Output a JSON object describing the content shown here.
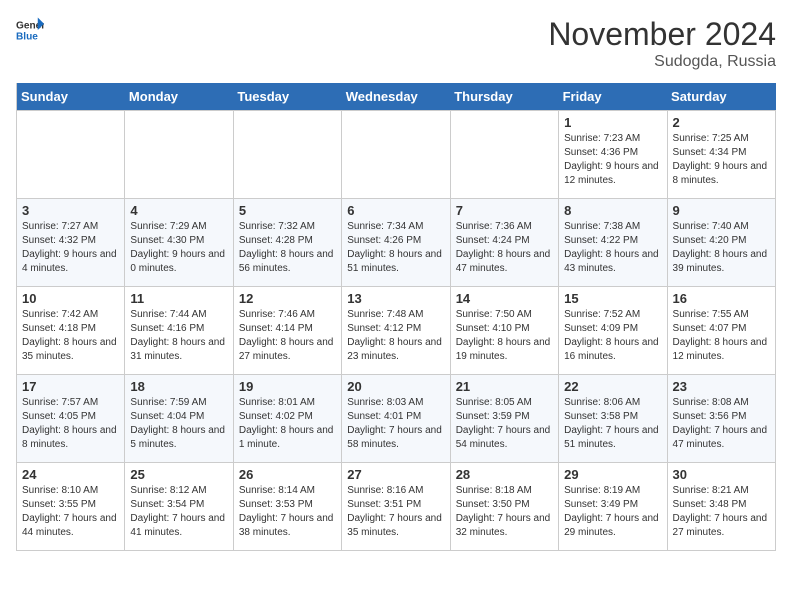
{
  "logo": {
    "text_general": "General",
    "text_blue": "Blue"
  },
  "title": "November 2024",
  "location": "Sudogda, Russia",
  "days_of_week": [
    "Sunday",
    "Monday",
    "Tuesday",
    "Wednesday",
    "Thursday",
    "Friday",
    "Saturday"
  ],
  "weeks": [
    [
      {
        "day": "",
        "info": ""
      },
      {
        "day": "",
        "info": ""
      },
      {
        "day": "",
        "info": ""
      },
      {
        "day": "",
        "info": ""
      },
      {
        "day": "",
        "info": ""
      },
      {
        "day": "1",
        "info": "Sunrise: 7:23 AM\nSunset: 4:36 PM\nDaylight: 9 hours and 12 minutes."
      },
      {
        "day": "2",
        "info": "Sunrise: 7:25 AM\nSunset: 4:34 PM\nDaylight: 9 hours and 8 minutes."
      }
    ],
    [
      {
        "day": "3",
        "info": "Sunrise: 7:27 AM\nSunset: 4:32 PM\nDaylight: 9 hours and 4 minutes."
      },
      {
        "day": "4",
        "info": "Sunrise: 7:29 AM\nSunset: 4:30 PM\nDaylight: 9 hours and 0 minutes."
      },
      {
        "day": "5",
        "info": "Sunrise: 7:32 AM\nSunset: 4:28 PM\nDaylight: 8 hours and 56 minutes."
      },
      {
        "day": "6",
        "info": "Sunrise: 7:34 AM\nSunset: 4:26 PM\nDaylight: 8 hours and 51 minutes."
      },
      {
        "day": "7",
        "info": "Sunrise: 7:36 AM\nSunset: 4:24 PM\nDaylight: 8 hours and 47 minutes."
      },
      {
        "day": "8",
        "info": "Sunrise: 7:38 AM\nSunset: 4:22 PM\nDaylight: 8 hours and 43 minutes."
      },
      {
        "day": "9",
        "info": "Sunrise: 7:40 AM\nSunset: 4:20 PM\nDaylight: 8 hours and 39 minutes."
      }
    ],
    [
      {
        "day": "10",
        "info": "Sunrise: 7:42 AM\nSunset: 4:18 PM\nDaylight: 8 hours and 35 minutes."
      },
      {
        "day": "11",
        "info": "Sunrise: 7:44 AM\nSunset: 4:16 PM\nDaylight: 8 hours and 31 minutes."
      },
      {
        "day": "12",
        "info": "Sunrise: 7:46 AM\nSunset: 4:14 PM\nDaylight: 8 hours and 27 minutes."
      },
      {
        "day": "13",
        "info": "Sunrise: 7:48 AM\nSunset: 4:12 PM\nDaylight: 8 hours and 23 minutes."
      },
      {
        "day": "14",
        "info": "Sunrise: 7:50 AM\nSunset: 4:10 PM\nDaylight: 8 hours and 19 minutes."
      },
      {
        "day": "15",
        "info": "Sunrise: 7:52 AM\nSunset: 4:09 PM\nDaylight: 8 hours and 16 minutes."
      },
      {
        "day": "16",
        "info": "Sunrise: 7:55 AM\nSunset: 4:07 PM\nDaylight: 8 hours and 12 minutes."
      }
    ],
    [
      {
        "day": "17",
        "info": "Sunrise: 7:57 AM\nSunset: 4:05 PM\nDaylight: 8 hours and 8 minutes."
      },
      {
        "day": "18",
        "info": "Sunrise: 7:59 AM\nSunset: 4:04 PM\nDaylight: 8 hours and 5 minutes."
      },
      {
        "day": "19",
        "info": "Sunrise: 8:01 AM\nSunset: 4:02 PM\nDaylight: 8 hours and 1 minute."
      },
      {
        "day": "20",
        "info": "Sunrise: 8:03 AM\nSunset: 4:01 PM\nDaylight: 7 hours and 58 minutes."
      },
      {
        "day": "21",
        "info": "Sunrise: 8:05 AM\nSunset: 3:59 PM\nDaylight: 7 hours and 54 minutes."
      },
      {
        "day": "22",
        "info": "Sunrise: 8:06 AM\nSunset: 3:58 PM\nDaylight: 7 hours and 51 minutes."
      },
      {
        "day": "23",
        "info": "Sunrise: 8:08 AM\nSunset: 3:56 PM\nDaylight: 7 hours and 47 minutes."
      }
    ],
    [
      {
        "day": "24",
        "info": "Sunrise: 8:10 AM\nSunset: 3:55 PM\nDaylight: 7 hours and 44 minutes."
      },
      {
        "day": "25",
        "info": "Sunrise: 8:12 AM\nSunset: 3:54 PM\nDaylight: 7 hours and 41 minutes."
      },
      {
        "day": "26",
        "info": "Sunrise: 8:14 AM\nSunset: 3:53 PM\nDaylight: 7 hours and 38 minutes."
      },
      {
        "day": "27",
        "info": "Sunrise: 8:16 AM\nSunset: 3:51 PM\nDaylight: 7 hours and 35 minutes."
      },
      {
        "day": "28",
        "info": "Sunrise: 8:18 AM\nSunset: 3:50 PM\nDaylight: 7 hours and 32 minutes."
      },
      {
        "day": "29",
        "info": "Sunrise: 8:19 AM\nSunset: 3:49 PM\nDaylight: 7 hours and 29 minutes."
      },
      {
        "day": "30",
        "info": "Sunrise: 8:21 AM\nSunset: 3:48 PM\nDaylight: 7 hours and 27 minutes."
      }
    ]
  ]
}
